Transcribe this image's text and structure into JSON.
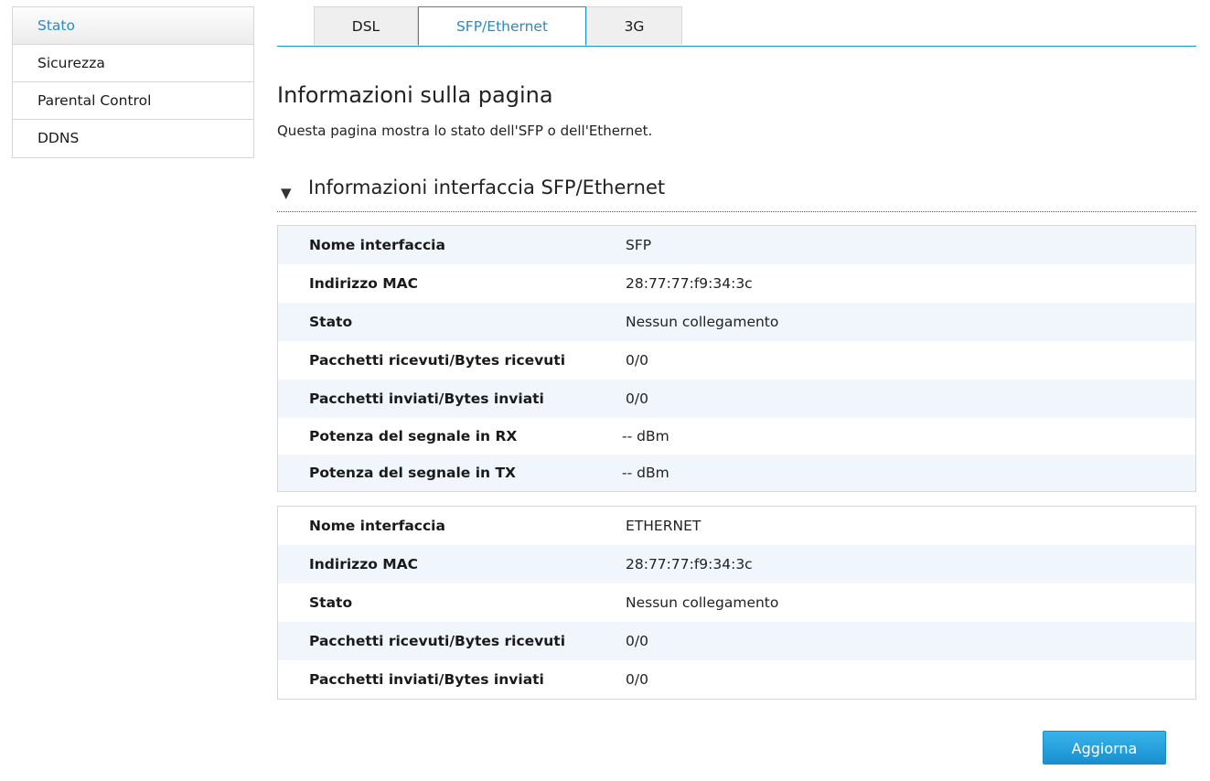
{
  "sidebar": {
    "items": [
      {
        "label": "Stato"
      },
      {
        "label": "Sicurezza"
      },
      {
        "label": "Parental Control"
      },
      {
        "label": "DDNS"
      }
    ]
  },
  "tabs": [
    {
      "label": "DSL"
    },
    {
      "label": "SFP/Ethernet"
    },
    {
      "label": "3G"
    }
  ],
  "page": {
    "title": "Informazioni sulla pagina",
    "description": "Questa pagina mostra lo stato dell'SFP o dell'Ethernet."
  },
  "section": {
    "title": "Informazioni interfaccia SFP/Ethernet"
  },
  "sfp_table": [
    {
      "label": "Nome interfaccia",
      "value": "SFP"
    },
    {
      "label": "Indirizzo MAC",
      "value": "28:77:77:f9:34:3c"
    },
    {
      "label": "Stato",
      "value": "Nessun collegamento"
    },
    {
      "label": "Pacchetti ricevuti/Bytes ricevuti",
      "value": "0/0"
    },
    {
      "label": "Pacchetti inviati/Bytes inviati",
      "value": "0/0"
    },
    {
      "label": "Potenza del segnale in RX",
      "value": "-- dBm"
    },
    {
      "label": "Potenza del segnale in TX",
      "value": "-- dBm"
    }
  ],
  "ethernet_table": [
    {
      "label": "Nome interfaccia",
      "value": "ETHERNET"
    },
    {
      "label": "Indirizzo MAC",
      "value": "28:77:77:f9:34:3c"
    },
    {
      "label": "Stato",
      "value": "Nessun collegamento"
    },
    {
      "label": "Pacchetti ricevuti/Bytes ricevuti",
      "value": "0/0"
    },
    {
      "label": "Pacchetti inviati/Bytes inviati",
      "value": "0/0"
    }
  ],
  "actions": {
    "refresh_label": "Aggiorna"
  },
  "colors": {
    "accent": "#2a8ac7",
    "tab_border": "#1a95c9",
    "row_stripe": "#f0f6fc",
    "button": "#1a8fd0"
  }
}
